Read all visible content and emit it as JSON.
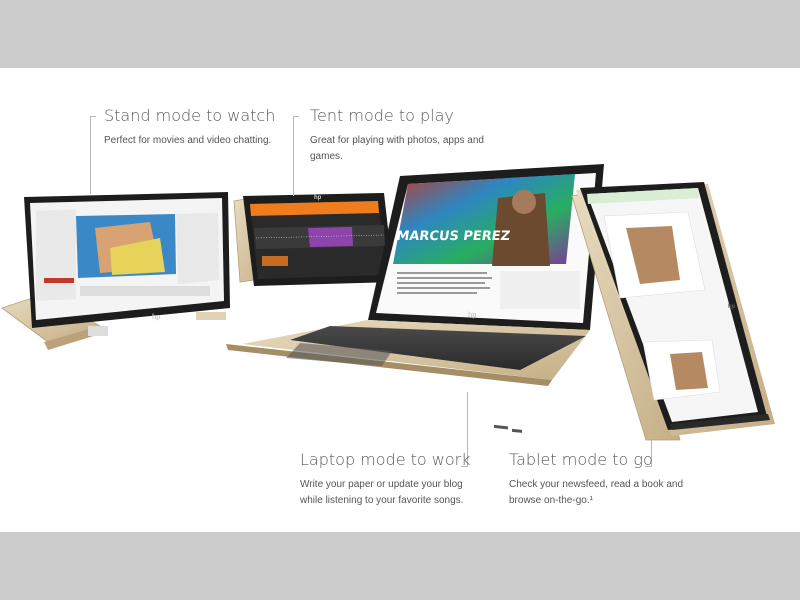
{
  "modes": [
    {
      "heading": "Stand mode to watch",
      "desc": "Perfect for movies and video chatting."
    },
    {
      "heading": "Tent mode to play",
      "desc": "Great for playing with photos, apps and games."
    },
    {
      "heading": "Laptop mode to work",
      "desc": "Write your paper or update your blog while listening to your favorite songs."
    },
    {
      "heading": "Tablet mode to go",
      "desc": "Check your newsfeed, read a book and browse on-the-go.¹"
    }
  ],
  "screen_text": {
    "blog_name": "MARCUS PEREZ"
  },
  "colors": {
    "frame_bg": "#cbcbcb",
    "gold": "#d8c7a4",
    "bezel": "#1d1d1d",
    "accent_orange": "#ef7d1e",
    "accent_green": "#8ec63f"
  },
  "logo": "hp"
}
